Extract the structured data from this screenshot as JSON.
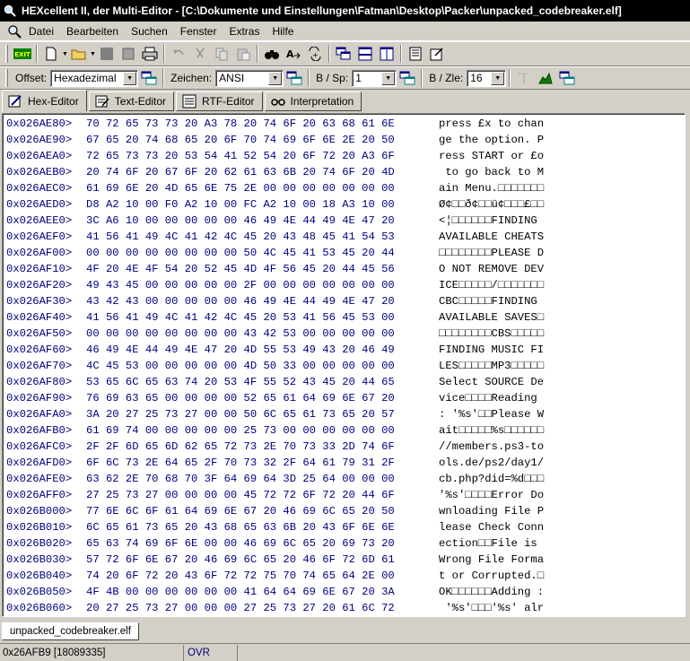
{
  "window": {
    "title": "HEXcellent II, der Multi-Editor - [C:\\Dokumente und Einstellungen\\Fatman\\Desktop\\Packer\\unpacked_codebreaker.elf]"
  },
  "menu": [
    "Datei",
    "Bearbeiten",
    "Suchen",
    "Fenster",
    "Extras",
    "Hilfe"
  ],
  "toolbar2": {
    "offset_label": "Offset:",
    "offset_value": "Hexadezimal",
    "zeichen_label": "Zeichen:",
    "zeichen_value": "ANSI",
    "bsp_label": "B / Sp:",
    "bsp_value": "1",
    "bzle_label": "B / Zle:",
    "bzle_value": "16"
  },
  "tabs": [
    {
      "label": "Hex-Editor",
      "icon": "hex-editor-icon",
      "active": true
    },
    {
      "label": "Text-Editor",
      "icon": "text-editor-icon",
      "active": false
    },
    {
      "label": "RTF-Editor",
      "icon": "rtf-editor-icon",
      "active": false
    },
    {
      "label": "Interpretation",
      "icon": "interpretation-icon",
      "active": false
    }
  ],
  "hex_rows": [
    {
      "addr": "0x026AE80>",
      "hex": "70 72 65 73 73 20 A3 78 20 74 6F 20 63 68 61 6E",
      "ascii": "press £x to chan"
    },
    {
      "addr": "0x026AE90>",
      "hex": "67 65 20 74 68 65 20 6F 70 74 69 6F 6E 2E 20 50",
      "ascii": "ge the option. P"
    },
    {
      "addr": "0x026AEA0>",
      "hex": "72 65 73 73 20 53 54 41 52 54 20 6F 72 20 A3 6F",
      "ascii": "ress START or £o"
    },
    {
      "addr": "0x026AEB0>",
      "hex": "20 74 6F 20 67 6F 20 62 61 63 6B 20 74 6F 20 4D",
      "ascii": " to go back to M"
    },
    {
      "addr": "0x026AEC0>",
      "hex": "61 69 6E 20 4D 65 6E 75 2E 00 00 00 00 00 00 00",
      "ascii": "ain Menu.□□□□□□□"
    },
    {
      "addr": "0x026AED0>",
      "hex": "D8 A2 10 00 F0 A2 10 00 FC A2 10 00 18 A3 10 00",
      "ascii": "Ø¢□□ð¢□□ü¢□□□£□□"
    },
    {
      "addr": "0x026AEE0>",
      "hex": "3C A6 10 00 00 00 00 00 46 49 4E 44 49 4E 47 20",
      "ascii": "<¦□□□□□□FINDING "
    },
    {
      "addr": "0x026AEF0>",
      "hex": "41 56 41 49 4C 41 42 4C 45 20 43 48 45 41 54 53",
      "ascii": "AVAILABLE CHEATS"
    },
    {
      "addr": "0x026AF00>",
      "hex": "00 00 00 00 00 00 00 00 50 4C 45 41 53 45 20 44",
      "ascii": "□□□□□□□□PLEASE D"
    },
    {
      "addr": "0x026AF10>",
      "hex": "4F 20 4E 4F 54 20 52 45 4D 4F 56 45 20 44 45 56",
      "ascii": "O NOT REMOVE DEV"
    },
    {
      "addr": "0x026AF20>",
      "hex": "49 43 45 00 00 00 00 00 2F 00 00 00 00 00 00 00",
      "ascii": "ICE□□□□□/□□□□□□□"
    },
    {
      "addr": "0x026AF30>",
      "hex": "43 42 43 00 00 00 00 00 46 49 4E 44 49 4E 47 20",
      "ascii": "CBC□□□□□FINDING "
    },
    {
      "addr": "0x026AF40>",
      "hex": "41 56 41 49 4C 41 42 4C 45 20 53 41 56 45 53 00",
      "ascii": "AVAILABLE SAVES□"
    },
    {
      "addr": "0x026AF50>",
      "hex": "00 00 00 00 00 00 00 00 43 42 53 00 00 00 00 00",
      "ascii": "□□□□□□□□CBS□□□□□"
    },
    {
      "addr": "0x026AF60>",
      "hex": "46 49 4E 44 49 4E 47 20 4D 55 53 49 43 20 46 49",
      "ascii": "FINDING MUSIC FI"
    },
    {
      "addr": "0x026AF70>",
      "hex": "4C 45 53 00 00 00 00 00 4D 50 33 00 00 00 00 00",
      "ascii": "LES□□□□□MP3□□□□□"
    },
    {
      "addr": "0x026AF80>",
      "hex": "53 65 6C 65 63 74 20 53 4F 55 52 43 45 20 44 65",
      "ascii": "Select SOURCE De"
    },
    {
      "addr": "0x026AF90>",
      "hex": "76 69 63 65 00 00 00 00 52 65 61 64 69 6E 67 20",
      "ascii": "vice□□□□Reading "
    },
    {
      "addr": "0x026AFA0>",
      "hex": "3A 20 27 25 73 27 00 00 50 6C 65 61 73 65 20 57",
      "ascii": ": '%s'□□Please W"
    },
    {
      "addr": "0x026AFB0>",
      "hex": "61 69 74 00 00 00 00 00 25 73 00 00 00 00 00 00",
      "ascii": "ait□□□□□%s□□□□□□"
    },
    {
      "addr": "0x026AFC0>",
      "hex": "2F 2F 6D 65 6D 62 65 72 73 2E 70 73 33 2D 74 6F",
      "ascii": "//members.ps3-to"
    },
    {
      "addr": "0x026AFD0>",
      "hex": "6F 6C 73 2E 64 65 2F 70 73 32 2F 64 61 79 31 2F",
      "ascii": "ols.de/ps2/day1/"
    },
    {
      "addr": "0x026AFE0>",
      "hex": "63 62 2E 70 68 70 3F 64 69 64 3D 25 64 00 00 00",
      "ascii": "cb.php?did=%d□□□"
    },
    {
      "addr": "0x026AFF0>",
      "hex": "27 25 73 27 00 00 00 00 45 72 72 6F 72 20 44 6F",
      "ascii": "'%s'□□□□Error Do"
    },
    {
      "addr": "0x026B000>",
      "hex": "77 6E 6C 6F 61 64 69 6E 67 20 46 69 6C 65 20 50",
      "ascii": "wnloading File P"
    },
    {
      "addr": "0x026B010>",
      "hex": "6C 65 61 73 65 20 43 68 65 63 6B 20 43 6F 6E 6E",
      "ascii": "lease Check Conn"
    },
    {
      "addr": "0x026B020>",
      "hex": "65 63 74 69 6F 6E 00 00 46 69 6C 65 20 69 73 20",
      "ascii": "ection□□File is "
    },
    {
      "addr": "0x026B030>",
      "hex": "57 72 6F 6E 67 20 46 69 6C 65 20 46 6F 72 6D 61",
      "ascii": "Wrong File Forma"
    },
    {
      "addr": "0x026B040>",
      "hex": "74 20 6F 72 20 43 6F 72 72 75 70 74 65 64 2E 00",
      "ascii": "t or Corrupted.□"
    },
    {
      "addr": "0x026B050>",
      "hex": "4F 4B 00 00 00 00 00 00 41 64 64 69 6E 67 20 3A",
      "ascii": "OK□□□□□□Adding :"
    },
    {
      "addr": "0x026B060>",
      "hex": "20 27 25 73 27 00 00 00 27 25 73 27 20 61 6C 72",
      "ascii": " '%s'□□□'%s' alr"
    }
  ],
  "document_tab": "unpacked_codebreaker.elf",
  "status": {
    "position": "0x26AFB9 [18089335]",
    "mode": "OVR"
  }
}
